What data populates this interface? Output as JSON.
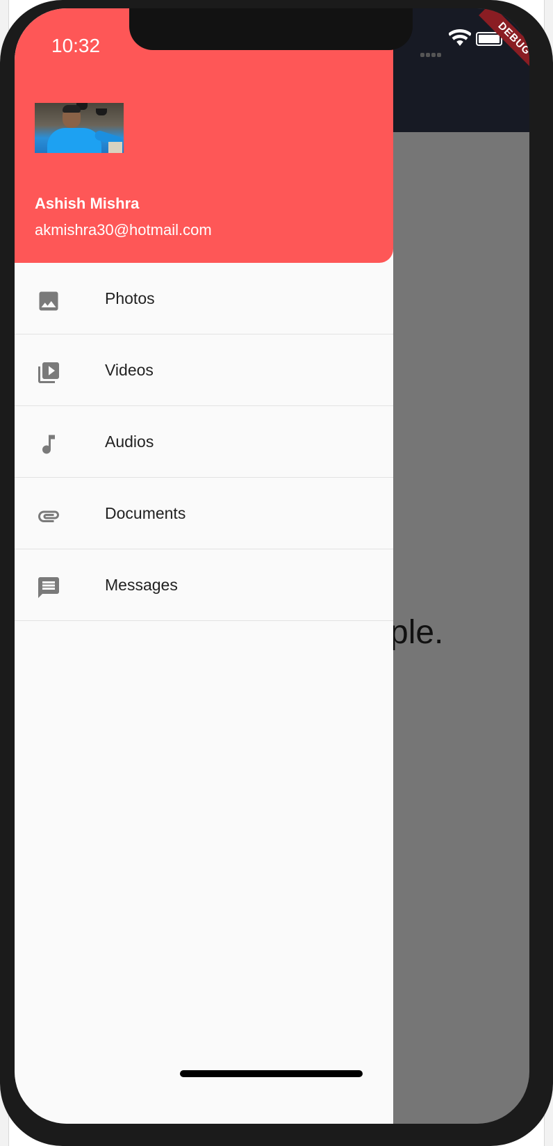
{
  "status_bar": {
    "time": "10:32"
  },
  "debug_banner": "DEBUG",
  "background": {
    "partial_text": "ple."
  },
  "drawer": {
    "header": {
      "user_name": "Ashish Mishra",
      "user_email": "akmishra30@hotmail.com",
      "background_color": "#fe5757"
    },
    "items": [
      {
        "label": "Photos",
        "icon": "image-icon"
      },
      {
        "label": "Videos",
        "icon": "video-library-icon"
      },
      {
        "label": "Audios",
        "icon": "music-note-icon"
      },
      {
        "label": "Documents",
        "icon": "attachment-icon"
      },
      {
        "label": "Messages",
        "icon": "message-icon"
      }
    ]
  },
  "colors": {
    "icon_gray": "#7a7a7a",
    "appbar": "#171a24",
    "scrim": "#767676"
  }
}
